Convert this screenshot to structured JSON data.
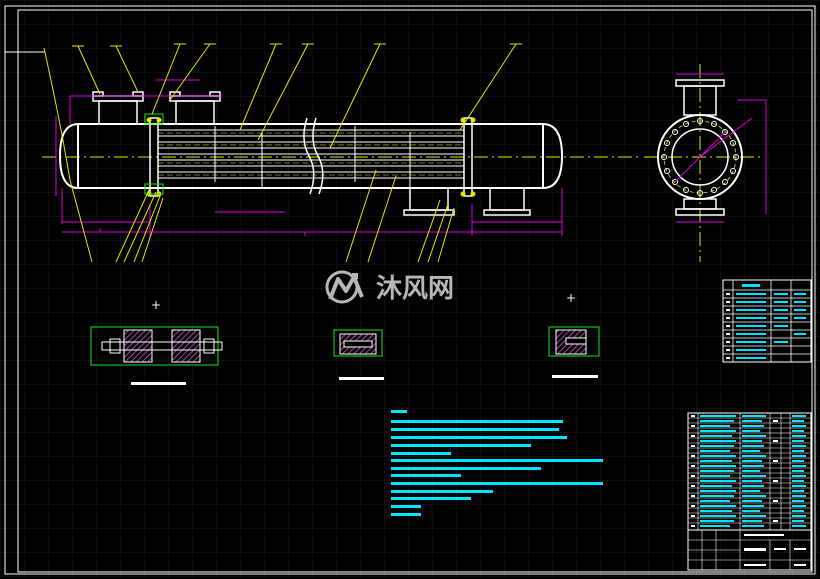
{
  "watermark": {
    "logo_mark": "MF",
    "brand_text": "沐风网"
  },
  "colors": {
    "background": "#000000",
    "grid": "#1a1a1a",
    "frame": "#ffffff",
    "outline": "#ffffff",
    "leader": "#e6e600",
    "dimension": "#e000e0",
    "annotation": "#00e5ff",
    "detail_box": "#19e619",
    "hatch": "#d35fd3",
    "table_line": "#ffffff",
    "table_fill": "#00e5ff",
    "watermark": "#d8d8d8"
  },
  "drawing": {
    "main_view": "heat-exchanger-elevation",
    "end_view": "flange-end-view",
    "detail_count": 3,
    "spec_table_rows": 10,
    "parts_list_rows": 23,
    "tech_notes_lines": 11
  }
}
